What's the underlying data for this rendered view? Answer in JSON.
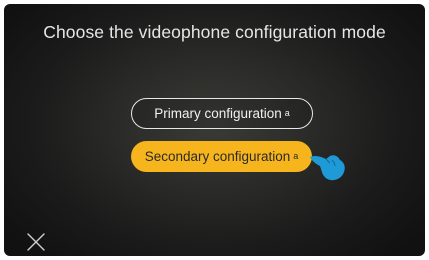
{
  "title": "Choose the videophone configuration mode",
  "buttons": {
    "primary_label": "Primary configuration",
    "primary_mark": "a",
    "secondary_label": "Secondary configuration",
    "secondary_mark": "a"
  },
  "icons": {
    "close": "close-icon",
    "pointer": "pointing-hand-icon"
  },
  "colors": {
    "accent": "#f7b51d",
    "hand": "#1e9ad6",
    "text": "#e6e6e6"
  }
}
